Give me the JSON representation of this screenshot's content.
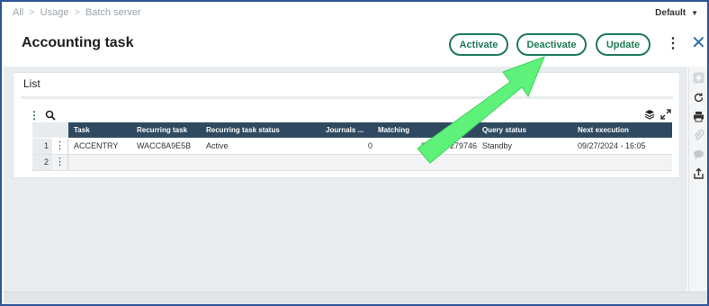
{
  "breadcrumb": [
    "All",
    "Usage",
    "Batch server"
  ],
  "profile": "Default",
  "page_title": "Accounting task",
  "actions": {
    "activate": "Activate",
    "deactivate": "Deactivate",
    "update": "Update"
  },
  "list": {
    "title": "List",
    "columns": [
      "Task",
      "Recurring task",
      "Recurring task status",
      "Journals ...",
      "Matching",
      "",
      "Query status",
      "Next execution"
    ],
    "rows": [
      {
        "num": "1",
        "task": "ACCENTRY",
        "recurring_task": "WACC8A9E5B",
        "status": "Active",
        "journals": "0",
        "matching": "8",
        "col6": "279746",
        "query_status": "Standby",
        "next_execution": "09/27/2024 - 16:05"
      },
      {
        "num": "2"
      }
    ]
  },
  "icons": [
    "plus-icon",
    "refresh-icon",
    "print-icon",
    "attachment-icon",
    "comment-icon",
    "export-icon",
    "search-icon",
    "layers-icon",
    "expand-icon",
    "close-icon"
  ],
  "colors": {
    "accent_green": "#1e7a55",
    "header_dark": "#2f4a60",
    "arrow_green": "#5ff27a",
    "frame_blue": "#2f5597"
  }
}
